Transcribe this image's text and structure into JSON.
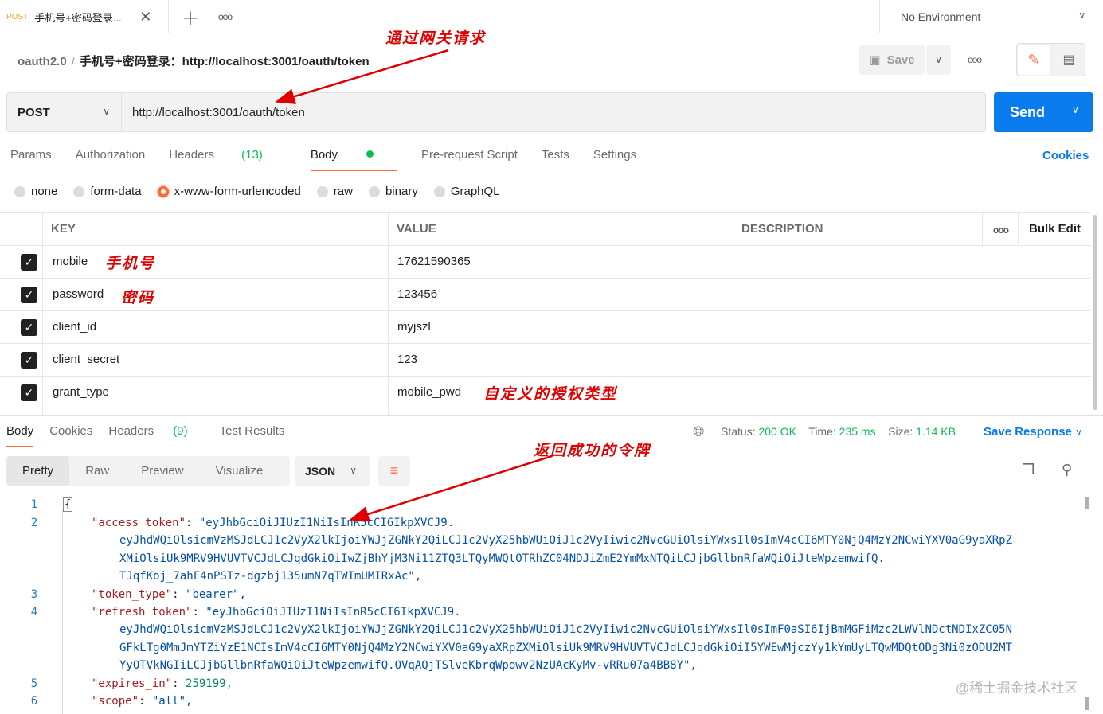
{
  "tab": {
    "method": "POST",
    "title": "手机号+密码登录..."
  },
  "environment": "No Environment",
  "breadcrumb": {
    "collection": "oauth2.0",
    "separator": "/",
    "request": "手机号+密码登录：http://localhost:3001/oauth/token"
  },
  "toolbar": {
    "save_label": "Save"
  },
  "request": {
    "method": "POST",
    "url": "http://localhost:3001/oauth/token",
    "send_label": "Send"
  },
  "request_tabs": [
    {
      "label": "Params"
    },
    {
      "label": "Authorization"
    },
    {
      "label": "Headers",
      "count": "(13)"
    },
    {
      "label": "Body"
    },
    {
      "label": "Pre-request Script"
    },
    {
      "label": "Tests"
    },
    {
      "label": "Settings"
    }
  ],
  "cookies_label": "Cookies",
  "body_types": [
    "none",
    "form-data",
    "x-www-form-urlencoded",
    "raw",
    "binary",
    "GraphQL"
  ],
  "body_type_selected": "x-www-form-urlencoded",
  "table": {
    "headers": {
      "key": "KEY",
      "value": "VALUE",
      "description": "DESCRIPTION",
      "bulk_edit": "Bulk Edit"
    },
    "rows": [
      {
        "key": "mobile",
        "value": "17621590365",
        "checked": true
      },
      {
        "key": "password",
        "value": "123456",
        "checked": true
      },
      {
        "key": "client_id",
        "value": "myjszl",
        "checked": true
      },
      {
        "key": "client_secret",
        "value": "123",
        "checked": true
      },
      {
        "key": "grant_type",
        "value": "mobile_pwd",
        "checked": true
      }
    ]
  },
  "annotations": {
    "gateway": "通过网关请求",
    "mobile": "手机号",
    "password": "密码",
    "grant_type": "自定义的授权类型",
    "token": "返回成功的令牌"
  },
  "response_tabs": [
    {
      "label": "Body"
    },
    {
      "label": "Cookies"
    },
    {
      "label": "Headers",
      "count": "(9)"
    },
    {
      "label": "Test Results"
    }
  ],
  "response_status": {
    "status_label": "Status:",
    "status": "200 OK",
    "time_label": "Time:",
    "time": "235 ms",
    "size_label": "Size:",
    "size": "1.14 KB",
    "save_response": "Save Response"
  },
  "format_tabs": [
    "Pretty",
    "Raw",
    "Preview",
    "Visualize"
  ],
  "format_language": "JSON",
  "code_lines": [
    {
      "n": "1",
      "text": "{"
    },
    {
      "n": "2",
      "key": "\"access_token\"",
      "val": "\"eyJhbGciOiJIUzI1NiIsInR5cCI6IkpXVCJ9."
    },
    {
      "n": "",
      "cont": "eyJhdWQiOlsicmVzMSJdLCJ1c2VyX2lkIjoiYWJjZGNkY2QiLCJ1c2VyX25hbWUiOiJ1c2VyIiwic2NvcGUiOlsiYWxsIl0sImV4cCI6MTY0NjQ4MzY2NCwiYXV0aG9yaXRpZ"
    },
    {
      "n": "",
      "cont": "XMiOlsiUk9MRV9HVUVTVCJdLCJqdGkiOiIwZjBhYjM3Ni11ZTQ3LTQyMWQtOTRhZC04NDJiZmE2YmMxNTQiLCJjbGllbnRfaWQiOiJteWpzemwifQ."
    },
    {
      "n": "",
      "cont": "TJqfKoj_7ahF4nPSTz-dgzbj135umN7qTWImUMIRxAc\","
    },
    {
      "n": "3",
      "key": "\"token_type\"",
      "val": "\"bearer\","
    },
    {
      "n": "4",
      "key": "\"refresh_token\"",
      "val": "\"eyJhbGciOiJIUzI1NiIsInR5cCI6IkpXVCJ9."
    },
    {
      "n": "",
      "cont": "eyJhdWQiOlsicmVzMSJdLCJ1c2VyX2lkIjoiYWJjZGNkY2QiLCJ1c2VyX25hbWUiOiJ1c2VyIiwic2NvcGUiOlsiYWxsIl0sImF0aSI6IjBmMGFiMzc2LWVlNDctNDIxZC05N"
    },
    {
      "n": "",
      "cont": "GFkLTg0MmJmYTZiYzE1NCIsImV4cCI6MTY0NjQ4MzY2NCwiYXV0aG9yaXRpZXMiOlsiUk9MRV9HVUVTVCJdLCJqdGkiOiI5YWEwMjczYy1kYmUyLTQwMDQtODg3Ni0zODU2MT"
    },
    {
      "n": "",
      "cont": "YyOTVkNGIiLCJjbGllbnRfaWQiOiJteWpzemwifQ.OVqAQjTSlveKbrqWpowv2NzUAcKyMv-vRRu07a4BB8Y\","
    },
    {
      "n": "5",
      "key": "\"expires_in\"",
      "num": "259199,"
    },
    {
      "n": "6",
      "key": "\"scope\"",
      "val": "\"all\","
    }
  ],
  "watermark": "@稀土掘金技术社区",
  "colors": {
    "accent": "#ff6c37",
    "primary": "#097bed",
    "success": "#0cbb52",
    "annotation": "#e00000"
  }
}
